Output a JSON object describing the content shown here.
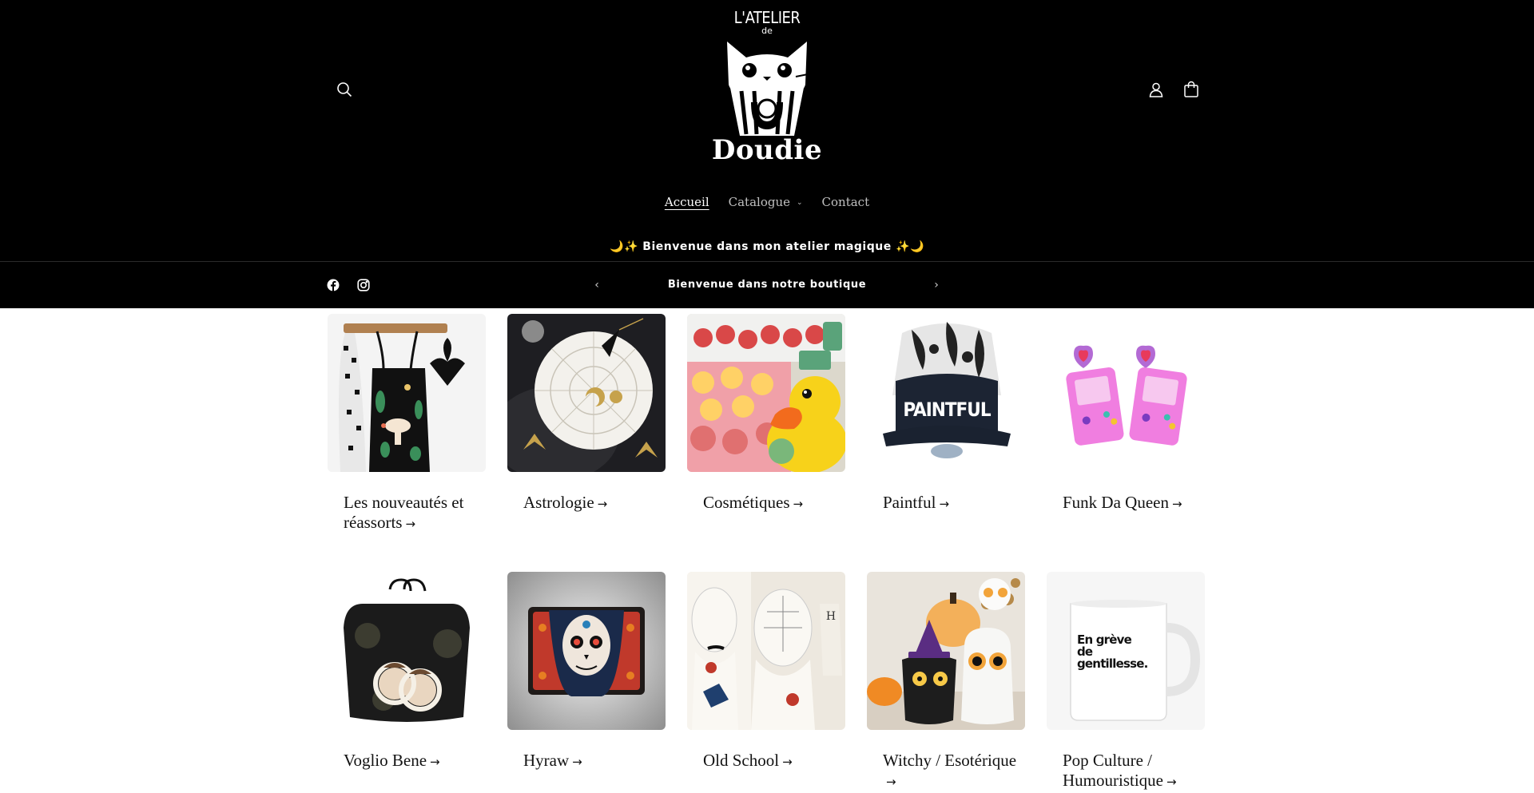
{
  "header": {
    "logo": {
      "top_text": "L'ATELIER",
      "de_text": "de",
      "bottom_text": "Doudie"
    },
    "icons": {
      "search": "search-icon",
      "account": "user-icon",
      "cart": "bag-icon"
    },
    "nav": [
      {
        "label": "Accueil",
        "active": true
      },
      {
        "label": "Catalogue",
        "dropdown": true
      },
      {
        "label": "Contact"
      }
    ]
  },
  "announcement": {
    "top_text": "🌙✨ Bienvenue dans mon atelier magique ✨🌙",
    "slide_text": "Bienvenue dans notre boutique",
    "prev_icon": "chevron-left-icon",
    "next_icon": "chevron-right-icon",
    "social": [
      "facebook-icon",
      "instagram-icon"
    ]
  },
  "collections": [
    {
      "title": "Les nouveautés et réassorts",
      "image": "tote-bag-mushroom"
    },
    {
      "title": "Astrologie",
      "image": "pendulum-board"
    },
    {
      "title": "Cosmétiques",
      "image": "bath-bombs-duck"
    },
    {
      "title": "Paintful",
      "image": "snapback-cap"
    },
    {
      "title": "Funk Da Queen",
      "image": "gameboy-earrings"
    },
    {
      "title": "Voglio Bene",
      "image": "black-tote-faces"
    },
    {
      "title": "Hyraw",
      "image": "sugar-skull-wallet"
    },
    {
      "title": "Old School",
      "image": "phrenology-heads"
    },
    {
      "title": "Witchy / Esotérique",
      "image": "cat-ghost-mugs"
    },
    {
      "title": "Pop Culture / Humouristique",
      "image": "white-mug"
    }
  ],
  "mug_text": "En grève de gentillesse.",
  "colors": {
    "header_bg": "#000000",
    "body_bg": "#ffffff",
    "text": "#121212"
  }
}
